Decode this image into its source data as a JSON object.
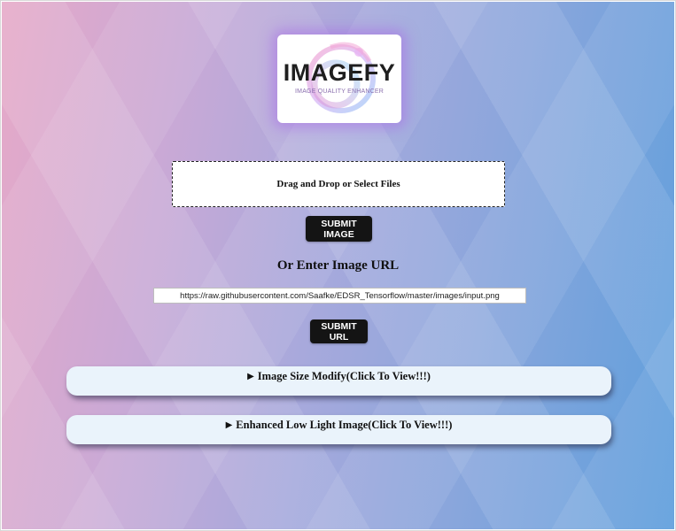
{
  "logo": {
    "title": "IMAGEFY",
    "subtitle": "IMAGE QUALITY ENHANCER"
  },
  "upload": {
    "dropzone_text": "Drag and Drop or Select Files",
    "submit_image_label": "SUBMIT IMAGE"
  },
  "url_section": {
    "label": "Or Enter Image URL",
    "input_value": "https://raw.githubusercontent.com/Saafke/EDSR_Tensorflow/master/images/input.png",
    "submit_url_label": "SUBMIT URL"
  },
  "sections": [
    {
      "label": "Image Size Modify(Click To View!!!)",
      "icon": "caret-right-icon"
    },
    {
      "label": "Enhanced Low Light Image(Click To View!!!)",
      "icon": "caret-right-icon"
    }
  ],
  "colors": {
    "button_bg": "#141414",
    "accordion_bg": "#eaf3fb",
    "logo_glow": "#aa6ee6"
  }
}
